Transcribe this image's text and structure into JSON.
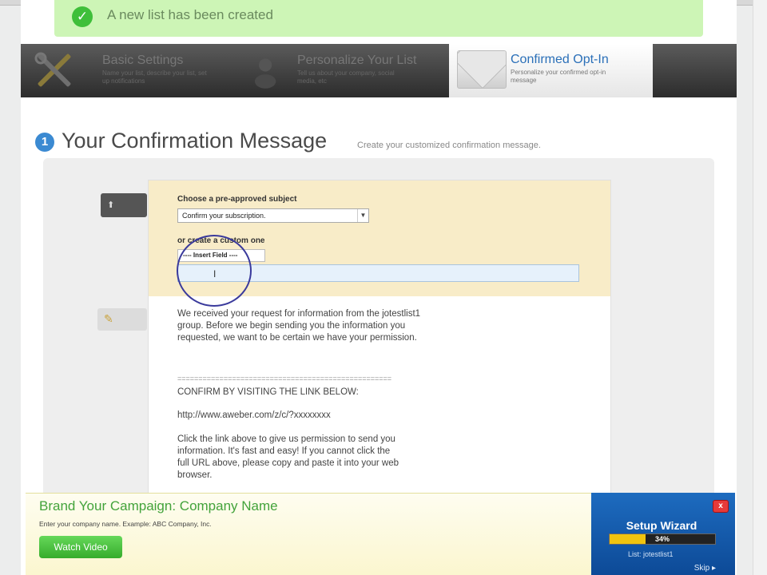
{
  "banner": {
    "message": "A new list has been created"
  },
  "steps": [
    {
      "title": "Basic Settings",
      "subtitle": "Name your list, describe your list, set up notifications"
    },
    {
      "title": "Personalize Your List",
      "subtitle": "Tell us about your company, social media, etc"
    },
    {
      "title": "Confirmed Opt-In",
      "subtitle": "Personalize your confirmed opt-in message"
    }
  ],
  "heading": {
    "number": "1",
    "title": "Your Confirmation Message",
    "subtitle": "Create your customized confirmation message."
  },
  "side_buttons": {
    "edit_icon": "pencil-icon",
    "up_icon": "arrow-up-icon"
  },
  "form": {
    "preapproved_label": "Choose a pre-approved subject",
    "preapproved_value": "Confirm your subscription.",
    "custom_label": "or create a custom one",
    "insert_field": "---- Insert Field ----",
    "custom_value": ""
  },
  "message": {
    "para1": "We received your request for information from the jotestlist1\ngroup. Before we begin sending you the information you\nrequested, we want to be certain we have your permission.",
    "divider": "===================================================",
    "confirm": "CONFIRM BY VISITING THE LINK BELOW:",
    "link": "http://www.aweber.com/z/c/?xxxxxxxx",
    "para2": "Click the link above to give us permission to send you\ninformation. It's fast and easy! If you cannot click the\nfull URL above, please copy and paste it into your web\nbrowser."
  },
  "brand": {
    "title": "Brand Your Campaign: Company Name",
    "subtitle": "Enter your company name. Example: ABC Company, Inc.",
    "watch_label": "Watch Video"
  },
  "wizard": {
    "close_label": "x",
    "title": "Setup Wizard",
    "progress_label": "34%",
    "progress": 0.34,
    "list_label": "List: jotestlist1",
    "skip_label": "Skip ▸"
  }
}
